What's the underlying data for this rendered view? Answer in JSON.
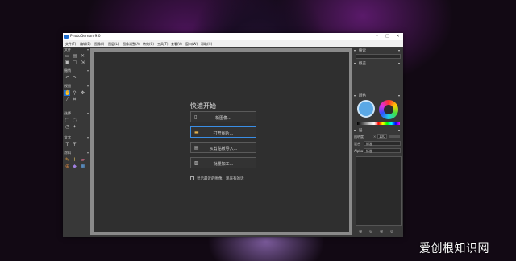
{
  "window": {
    "title": "PhotoDemon 9.0",
    "controls": [
      "–",
      "□",
      "✕"
    ]
  },
  "menu": [
    "文件(F)",
    "编辑(E)",
    "图像(I)",
    "图层(L)",
    "图像调整(A)",
    "特效(C)",
    "工具(T)",
    "查看(V)",
    "窗口(W)",
    "帮助(H)"
  ],
  "toolbox": {
    "sections": [
      "文件",
      "撤销",
      "视图",
      "选择",
      "文字",
      "涂料"
    ]
  },
  "quick_start": {
    "title": "快速开始",
    "buttons": [
      {
        "label": "新图像...",
        "icon": "new-file-icon"
      },
      {
        "label": "打开图片...",
        "icon": "folder-icon"
      },
      {
        "label": "从剪贴板导入...",
        "icon": "clipboard-icon"
      },
      {
        "label": "批量加工...",
        "icon": "batch-image-icon"
      }
    ],
    "checkbox_label": "显示最近的图像、现来有的话"
  },
  "right_panel": {
    "search_label": "搜索",
    "overview_label": "概览",
    "color_label": "颜色",
    "layers_label": "层",
    "opacity_label": "透明度:",
    "opacity_value": "100",
    "blend_label": "混合",
    "blend_value": "标准",
    "alpha_label": "Alpha",
    "alpha_value": "标准"
  },
  "watermark": "爱创根知识网",
  "colors": {
    "accent": "#1f6fd0",
    "focus_border": "#3a8ee6",
    "panel_bg": "#383838",
    "canvas_bg": "#2f2f2f"
  }
}
